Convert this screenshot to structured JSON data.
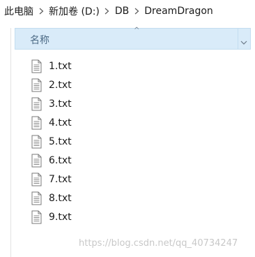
{
  "breadcrumb": [
    "此电脑",
    "新加卷 (D:)",
    "DB",
    "DreamDragon"
  ],
  "column_header": {
    "name_label": "名称",
    "sort_indicator": "^"
  },
  "files": [
    {
      "name": "1.txt",
      "icon": "text-file-icon"
    },
    {
      "name": "2.txt",
      "icon": "text-file-icon"
    },
    {
      "name": "3.txt",
      "icon": "text-file-icon"
    },
    {
      "name": "4.txt",
      "icon": "text-file-icon"
    },
    {
      "name": "5.txt",
      "icon": "text-file-icon"
    },
    {
      "name": "6.txt",
      "icon": "text-file-icon"
    },
    {
      "name": "7.txt",
      "icon": "text-file-icon"
    },
    {
      "name": "8.txt",
      "icon": "text-file-icon"
    },
    {
      "name": "9.txt",
      "icon": "text-file-icon"
    }
  ],
  "watermark": "https://blog.csdn.net/qq_40734247",
  "colors": {
    "header_bg": "#d9ebf9",
    "header_text": "#4d6b86"
  }
}
